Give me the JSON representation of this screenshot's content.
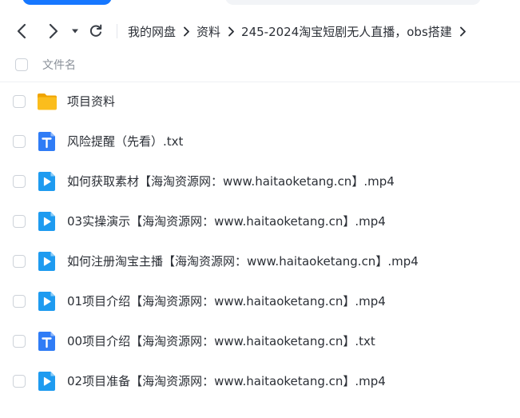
{
  "breadcrumb": [
    {
      "label": "我的网盘"
    },
    {
      "label": "资料"
    },
    {
      "label": "245-2024淘宝短剧无人直播，obs搭建"
    }
  ],
  "header": {
    "name_label": "文件名"
  },
  "files": [
    {
      "name": "项目资料",
      "type": "folder",
      "icon": "folder-icon"
    },
    {
      "name": "风险提醒（先看）.txt",
      "type": "txt",
      "icon": "text-file-icon"
    },
    {
      "name": "如何获取素材【海淘资源网：www.haitaoketang.cn】.mp4",
      "type": "video",
      "icon": "video-file-icon"
    },
    {
      "name": "03实操演示【海淘资源网：www.haitaoketang.cn】.mp4",
      "type": "video",
      "icon": "video-file-icon"
    },
    {
      "name": "如何注册淘宝主播【海淘资源网：www.haitaoketang.cn】.mp4",
      "type": "video",
      "icon": "video-file-icon"
    },
    {
      "name": "01项目介绍【海淘资源网：www.haitaoketang.cn】.mp4",
      "type": "video",
      "icon": "video-file-icon"
    },
    {
      "name": "00项目介绍【海淘资源网：www.haitaoketang.cn】.txt",
      "type": "txt",
      "icon": "text-file-icon"
    },
    {
      "name": "02项目准备【海淘资源网：www.haitaoketang.cn】.mp4",
      "type": "video",
      "icon": "video-file-icon"
    }
  ],
  "colors": {
    "accent": "#1677ff",
    "folder": "#f7b500",
    "text_icon": "#2f7cf6",
    "video_icon": "#1e9bf0"
  }
}
